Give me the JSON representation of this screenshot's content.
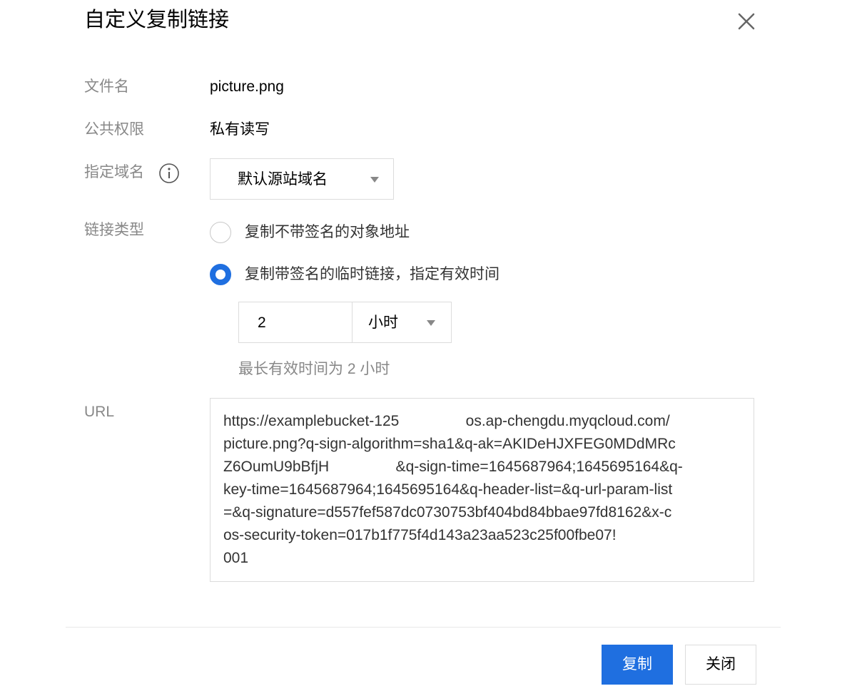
{
  "dialog": {
    "title": "自定义复制链接"
  },
  "fields": {
    "filename_label": "文件名",
    "filename_value": "picture.png",
    "permission_label": "公共权限",
    "permission_value": "私有读写",
    "domain_label": "指定域名",
    "domain_selected": "默认源站域名",
    "link_type_label": "链接类型",
    "url_label": "URL"
  },
  "link_options": [
    {
      "label": "复制不带签名的对象地址",
      "selected": false
    },
    {
      "label": "复制带签名的临时链接，指定有效时间",
      "selected": true
    }
  ],
  "validity": {
    "value": "2",
    "unit": "小时",
    "hint": "最长有效时间为 2 小时"
  },
  "url_lines": [
    "https://examplebucket-125                os.ap-chengdu.myqcloud.com/",
    "picture.png?q-sign-algorithm=sha1&q-ak=AKIDeHJXFEG0MDdMRc",
    "Z6OumU9bBfjH                &q-sign-time=1645687964;1645695164&q-",
    "key-time=1645687964;1645695164&q-header-list=&q-url-param-list",
    "=&q-signature=d557fef587dc0730753bf404bd84bbae97fd8162&x-c",
    "os-security-token=017b1f775f4d143a23aa523c25f00fbe07!",
    "001"
  ],
  "buttons": {
    "copy_label": "复制",
    "close_label": "关闭"
  },
  "colors": {
    "primary": "#1f6fe0",
    "label_gray": "#888888",
    "border": "#dcdcdc"
  },
  "icons": {
    "close": "close-icon",
    "info": "info-icon",
    "dropdown": "caret-down-icon"
  }
}
